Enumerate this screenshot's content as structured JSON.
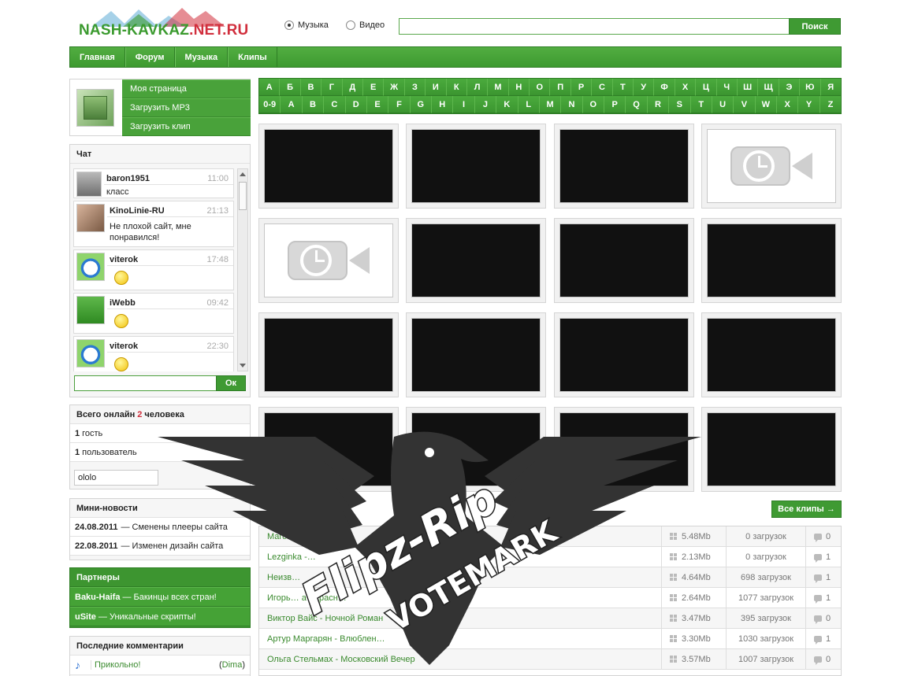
{
  "header": {
    "logo_text_main": "NASH-KAVKAZ",
    "logo_text_accent": ".NET.RU",
    "radio_music": "Музыка",
    "radio_video": "Видео",
    "search_placeholder": "",
    "search_button": "Поиск"
  },
  "nav": [
    "Главная",
    "Форум",
    "Музыка",
    "Клипы"
  ],
  "profile_menu": [
    "Моя страница",
    "Загрузить MP3",
    "Загрузить клип"
  ],
  "chat": {
    "title": "Чат",
    "messages": [
      {
        "nick": "baron1951",
        "time": "11:00",
        "text": "класс"
      },
      {
        "nick": "KinoLinie-RU",
        "time": "21:13",
        "text": "Не плохой сайт, мне понравился!"
      },
      {
        "nick": "viterok",
        "time": "17:48",
        "text": ""
      },
      {
        "nick": "iWebb",
        "time": "09:42",
        "text": ""
      },
      {
        "nick": "viterok",
        "time": "22:30",
        "text": ""
      }
    ],
    "ok_button": "Ок"
  },
  "online": {
    "title_pre": "Всего онлайн",
    "count": "2",
    "title_post": "человека",
    "guests_count": "1",
    "guests_label": "гость",
    "users_count": "1",
    "users_label": "пользователь",
    "user_name": "ololo"
  },
  "news": {
    "title": "Мини-новости",
    "items": [
      {
        "date": "24.08.2011",
        "text": "— Сменены плееры сайта"
      },
      {
        "date": "22.08.2011",
        "text": "— Изменен дизайн сайта"
      }
    ]
  },
  "partners": {
    "title": "Партнеры",
    "items": [
      {
        "name": "Baku-Haifa",
        "text": "— Бакинцы всех стран!"
      },
      {
        "name": "uSite",
        "text": "— Уникальные скрипты!"
      }
    ]
  },
  "comments": {
    "title": "Последние комментарии",
    "items": [
      {
        "text": "Прикольно!",
        "user": "Dima"
      }
    ]
  },
  "alphabet": {
    "row1": [
      "А",
      "Б",
      "В",
      "Г",
      "Д",
      "Е",
      "Ж",
      "З",
      "И",
      "К",
      "Л",
      "М",
      "Н",
      "О",
      "П",
      "Р",
      "С",
      "Т",
      "У",
      "Ф",
      "Х",
      "Ц",
      "Ч",
      "Ш",
      "Щ",
      "Э",
      "Ю",
      "Я"
    ],
    "row2": [
      "0-9",
      "A",
      "B",
      "C",
      "D",
      "E",
      "F",
      "G",
      "H",
      "I",
      "J",
      "K",
      "L",
      "M",
      "N",
      "O",
      "P",
      "Q",
      "R",
      "S",
      "T",
      "U",
      "V",
      "W",
      "X",
      "Y",
      "Z"
    ]
  },
  "all_clips_button": "Все клипы →",
  "tracks": [
    {
      "name": "Магоме…",
      "size": "5.48Mb",
      "downloads": "0 загрузок",
      "comments": "0"
    },
    {
      "name": "Lezginka -…",
      "size": "2.13Mb",
      "downloads": "0 загрузок",
      "comments": "1"
    },
    {
      "name": "Неизв…",
      "size": "4.64Mb",
      "downloads": "698 загрузок",
      "comments": "1"
    },
    {
      "name": "Игорь… а - Красн…",
      "size": "2.64Mb",
      "downloads": "1077 загрузок",
      "comments": "1"
    },
    {
      "name": "Виктор Вайс - Ночной Роман",
      "size": "3.47Mb",
      "downloads": "395 загрузок",
      "comments": "0"
    },
    {
      "name": "Артур Маргарян - Влюблен…",
      "size": "3.30Mb",
      "downloads": "1030 загрузок",
      "comments": "1"
    },
    {
      "name": "Ольга Стельмах - Московский Вечер",
      "size": "3.57Mb",
      "downloads": "1007 загрузок",
      "comments": "0"
    }
  ],
  "watermark": {
    "line1": "Flipz-Rip",
    "line2": "VOTEMARK"
  }
}
